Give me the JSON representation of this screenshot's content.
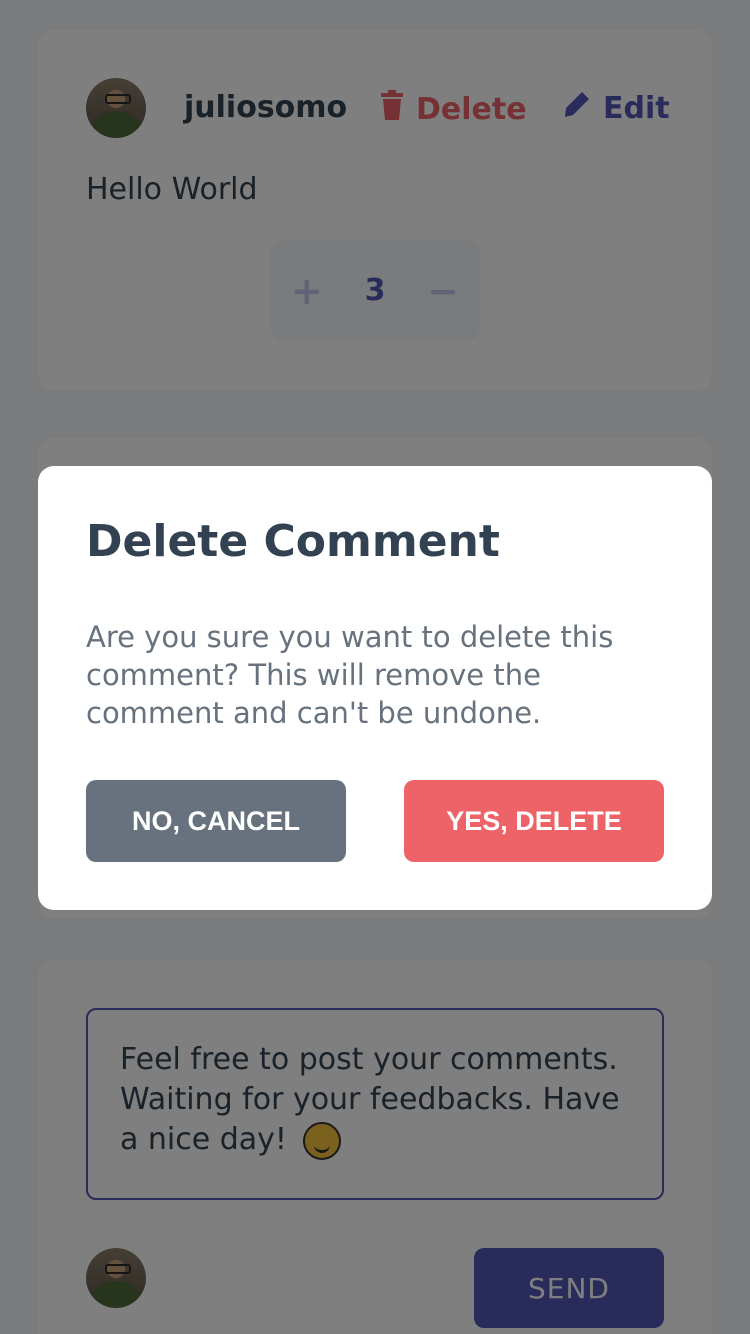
{
  "comment": {
    "username": "juliosomo",
    "delete_label": "Delete",
    "edit_label": "Edit",
    "text": "Hello World",
    "score": "3",
    "upvote_symbol": "+",
    "downvote_symbol": "−"
  },
  "compose": {
    "text": "Feel free to post your comments. Waiting for your feedbacks. Have a nice day!",
    "send_label": "SEND"
  },
  "modal": {
    "title": "Delete Comment",
    "body": "Are you sure you want to delete this comment? This will remove the comment and can't be undone.",
    "cancel_label": "NO, CANCEL",
    "confirm_label": "YES, DELETE"
  },
  "colors": {
    "accent": "#5357b6",
    "danger": "#ed6368",
    "neutral": "#67727e",
    "text": "#334253",
    "background": "#f5f6fa"
  },
  "icons": {
    "delete": "trash-icon",
    "edit": "pencil-icon",
    "emoji": "smiling-face-icon"
  }
}
